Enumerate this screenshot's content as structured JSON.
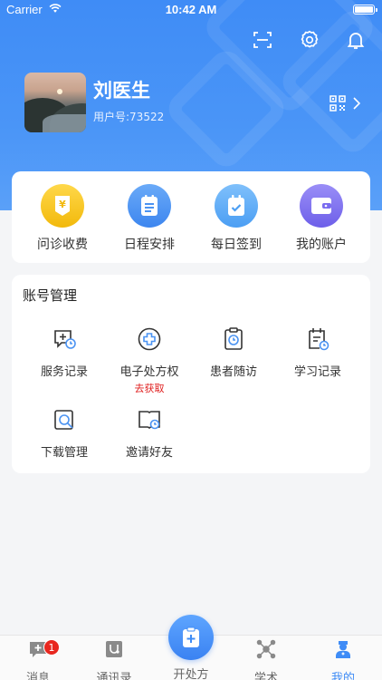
{
  "status_bar": {
    "carrier": "Carrier",
    "time": "10:42 AM"
  },
  "profile": {
    "name": "刘医生",
    "user_id": "用户号:73522"
  },
  "quick_actions": [
    {
      "label": "问诊收费",
      "icon": "yen-fee-icon",
      "color": "#f6c21a"
    },
    {
      "label": "日程安排",
      "icon": "schedule-icon",
      "color": "#4b93f2"
    },
    {
      "label": "每日签到",
      "icon": "calendar-check-icon",
      "color": "#5aaaf5"
    },
    {
      "label": "我的账户",
      "icon": "wallet-icon",
      "color": "#7a6cf0"
    }
  ],
  "account": {
    "title": "账号管理",
    "items": [
      {
        "label": "服务记录",
        "icon": "service-record-icon"
      },
      {
        "label": "电子处方权",
        "sub": "去获取",
        "icon": "prescription-icon"
      },
      {
        "label": "患者随访",
        "icon": "patient-followup-icon"
      },
      {
        "label": "学习记录",
        "icon": "study-record-icon"
      },
      {
        "label": "下载管理",
        "icon": "download-manage-icon"
      },
      {
        "label": "邀请好友",
        "icon": "invite-friend-icon"
      }
    ]
  },
  "tabbar": {
    "tabs": [
      {
        "label": "消息",
        "icon": "message-icon",
        "badge": "1"
      },
      {
        "label": "通讯录",
        "icon": "contacts-icon"
      },
      {
        "label": "开处方",
        "icon": "prescribe-icon"
      },
      {
        "label": "学术",
        "icon": "academic-icon"
      },
      {
        "label": "我的",
        "icon": "doctor-profile-icon",
        "active": true
      }
    ]
  },
  "colors": {
    "primary": "#3f8cf6",
    "badge": "#e8271f",
    "alert_text": "#e02020"
  }
}
